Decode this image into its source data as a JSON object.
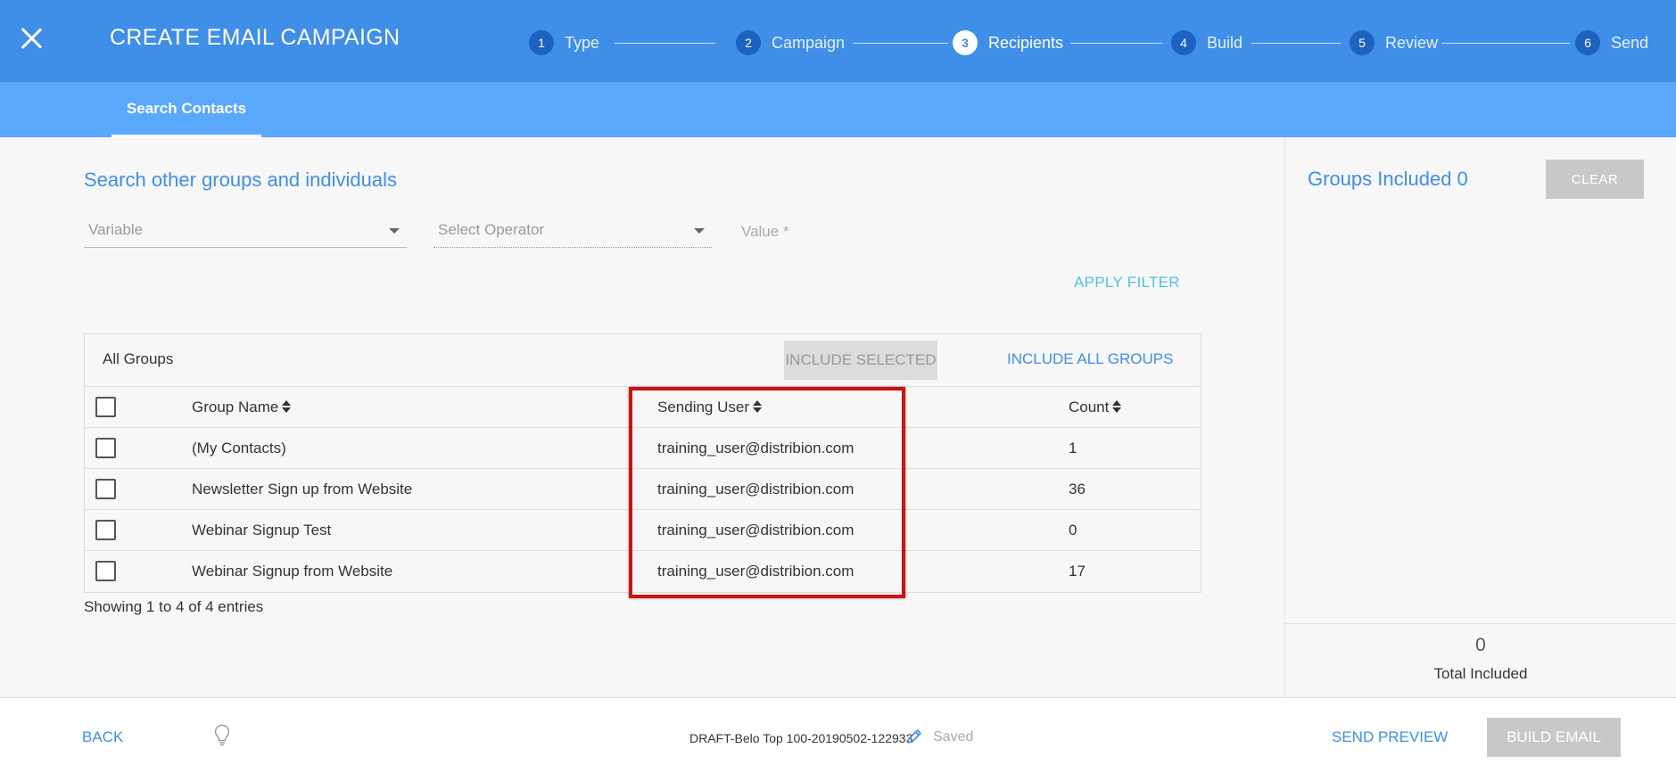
{
  "header": {
    "title": "CREATE EMAIL CAMPAIGN",
    "close_icon": "close-icon",
    "steps": [
      {
        "num": "1",
        "label": "Type"
      },
      {
        "num": "2",
        "label": "Campaign"
      },
      {
        "num": "3",
        "label": "Recipients"
      },
      {
        "num": "4",
        "label": "Build"
      },
      {
        "num": "5",
        "label": "Review"
      },
      {
        "num": "6",
        "label": "Send"
      }
    ],
    "active_step": "3"
  },
  "subnav": {
    "tab_label": "Search Contacts"
  },
  "search": {
    "title": "Search other groups and individuals",
    "variable_placeholder": "Variable",
    "operator_placeholder": "Select Operator",
    "value_placeholder": "Value *",
    "apply_filter_label": "APPLY FILTER"
  },
  "groups_table": {
    "heading": "All Groups",
    "include_selected_label": "INCLUDE SELECTED",
    "include_all_label": "INCLUDE ALL GROUPS",
    "columns": [
      "Group Name",
      "Sending User",
      "Count"
    ],
    "rows": [
      {
        "name": "(My Contacts)",
        "user": "training_user@distribion.com",
        "count": "1"
      },
      {
        "name": "Newsletter Sign up from Website",
        "user": "training_user@distribion.com",
        "count": "36"
      },
      {
        "name": "Webinar Signup Test",
        "user": "training_user@distribion.com",
        "count": "0"
      },
      {
        "name": "Webinar Signup from Website",
        "user": "training_user@distribion.com",
        "count": "17"
      }
    ],
    "entries_text": "Showing 1 to 4 of 4 entries"
  },
  "sidebar": {
    "groups_included_label": "Groups Included 0",
    "clear_label": "CLEAR",
    "total_count": "0",
    "total_label": "Total Included"
  },
  "footer": {
    "back_label": "BACK",
    "draft_name": "DRAFT-Belo Top 100-20190502-122933",
    "saved_label": "Saved",
    "send_preview_label": "SEND PREVIEW",
    "build_email_label": "BUILD EMAIL"
  },
  "colors": {
    "header_bg": "#3f8ee8",
    "subnav_bg": "#59a8fb",
    "accent": "#3f8ee8",
    "highlight_border": "#cc1111"
  }
}
